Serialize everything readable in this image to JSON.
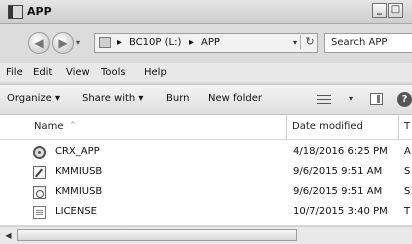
{
  "window": {
    "title": "APP",
    "minimize_glyph": "_",
    "maximize_glyph": "□"
  },
  "address": {
    "back_glyph": "◀",
    "forward_glyph": "▶",
    "drop_glyph": "▾",
    "separator": "▸",
    "crumbs": [
      "BC10P (L:)",
      "APP"
    ],
    "refresh_glyph": "↻",
    "search_placeholder": "Search APP"
  },
  "menu": {
    "items": [
      "File",
      "Edit",
      "View",
      "Tools",
      "Help"
    ]
  },
  "toolbar": {
    "organize": "Organize ▾",
    "share_with": "Share with ▾",
    "burn": "Burn",
    "new_folder": "New folder",
    "view_drop": "▾",
    "help_glyph": "?"
  },
  "columns": {
    "name": "Name",
    "sort_glyph": "^",
    "date_modified": "Date modified",
    "type": "T"
  },
  "files": [
    {
      "name": "CRX_APP",
      "date": "4/18/2016 6:25 PM",
      "type": "A",
      "icon": "application-icon"
    },
    {
      "name": "KMMIUSB",
      "date": "9/6/2015 9:51 AM",
      "type": "S",
      "icon": "setup-info-icon"
    },
    {
      "name": "KMMIUSB",
      "date": "9/6/2015 9:51 AM",
      "type": "S",
      "icon": "system-file-icon"
    },
    {
      "name": "LICENSE",
      "date": "10/7/2015 3:40 PM",
      "type": "T",
      "icon": "text-file-icon"
    }
  ],
  "scroll": {
    "left_glyph": "◀"
  }
}
